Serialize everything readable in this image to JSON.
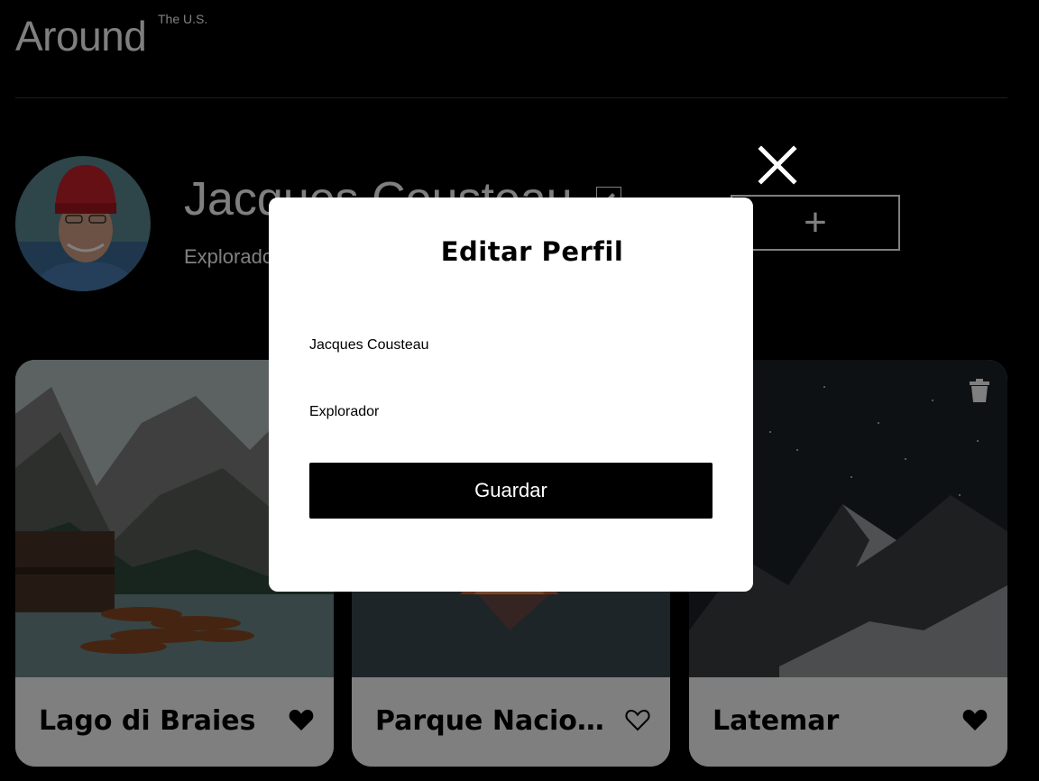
{
  "header": {
    "logo_text": "Around",
    "logo_sup": "The U.S."
  },
  "profile": {
    "name": "Jacques Cousteau",
    "about": "Explorador",
    "add_button_symbol": "+",
    "edit_button_icon": "pencil-icon",
    "avatar_icon": "avatar-photo"
  },
  "cards": [
    {
      "title": "Lago di Braies",
      "liked": true,
      "like_icon": "heart-filled-icon",
      "image": "mountain-lake-with-boats"
    },
    {
      "title": "Parque Nacional de la Vanoise",
      "liked": false,
      "like_icon": "heart-outline-icon",
      "image": "mountain-lake-sunset"
    },
    {
      "title": "Latemar",
      "liked": true,
      "like_icon": "heart-filled-icon",
      "image": "mountains-starry-night",
      "trash_icon": "trash-icon"
    }
  ],
  "modal": {
    "title": "Editar Perfil",
    "name_value": "Jacques Cousteau",
    "about_value": "Explorador",
    "save_label": "Guardar",
    "close_icon": "close-icon"
  },
  "colors": {
    "background": "#000000",
    "modal_background": "#FFFFFF",
    "overlay": "rgba(0,0,0,0.5)",
    "button": "#000000"
  }
}
